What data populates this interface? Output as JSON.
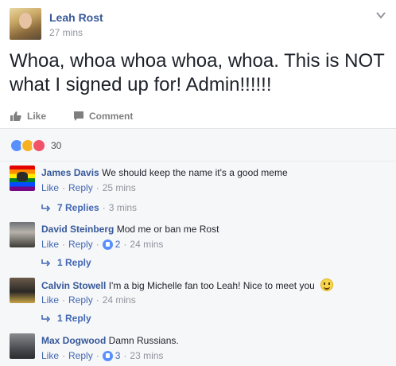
{
  "post": {
    "author": "Leah Rost",
    "time": "27 mins",
    "text": "Whoa, whoa whoa whoa, whoa. This is NOT what I signed up for! Admin!!!!!!"
  },
  "actions": {
    "like_label": "Like",
    "comment_label": "Comment"
  },
  "reactions": {
    "icons": [
      "like-reaction-icon",
      "haha-reaction-icon",
      "love-reaction-icon"
    ],
    "count": "30"
  },
  "comments": [
    {
      "name": "James Davis",
      "text": "We should keep the name it's a good meme",
      "like": "Like",
      "reply": "Reply",
      "likes": "",
      "time": "25 mins",
      "replies": {
        "label": "7 Replies",
        "time": "3 mins"
      }
    },
    {
      "name": "David Steinberg",
      "text": "Mod me or ban me Rost",
      "like": "Like",
      "reply": "Reply",
      "likes": "2",
      "time": "24 mins",
      "replies": {
        "label": "1 Reply",
        "time": ""
      }
    },
    {
      "name": "Calvin Stowell",
      "text": "I'm a big Michelle fan too Leah! Nice to meet you",
      "like": "Like",
      "reply": "Reply",
      "likes": "",
      "time": "24 mins",
      "replies": {
        "label": "1 Reply",
        "time": ""
      }
    },
    {
      "name": "Max Dogwood",
      "text": "Damn Russians.",
      "like": "Like",
      "reply": "Reply",
      "likes": "3",
      "time": "23 mins"
    }
  ],
  "separator": "·"
}
